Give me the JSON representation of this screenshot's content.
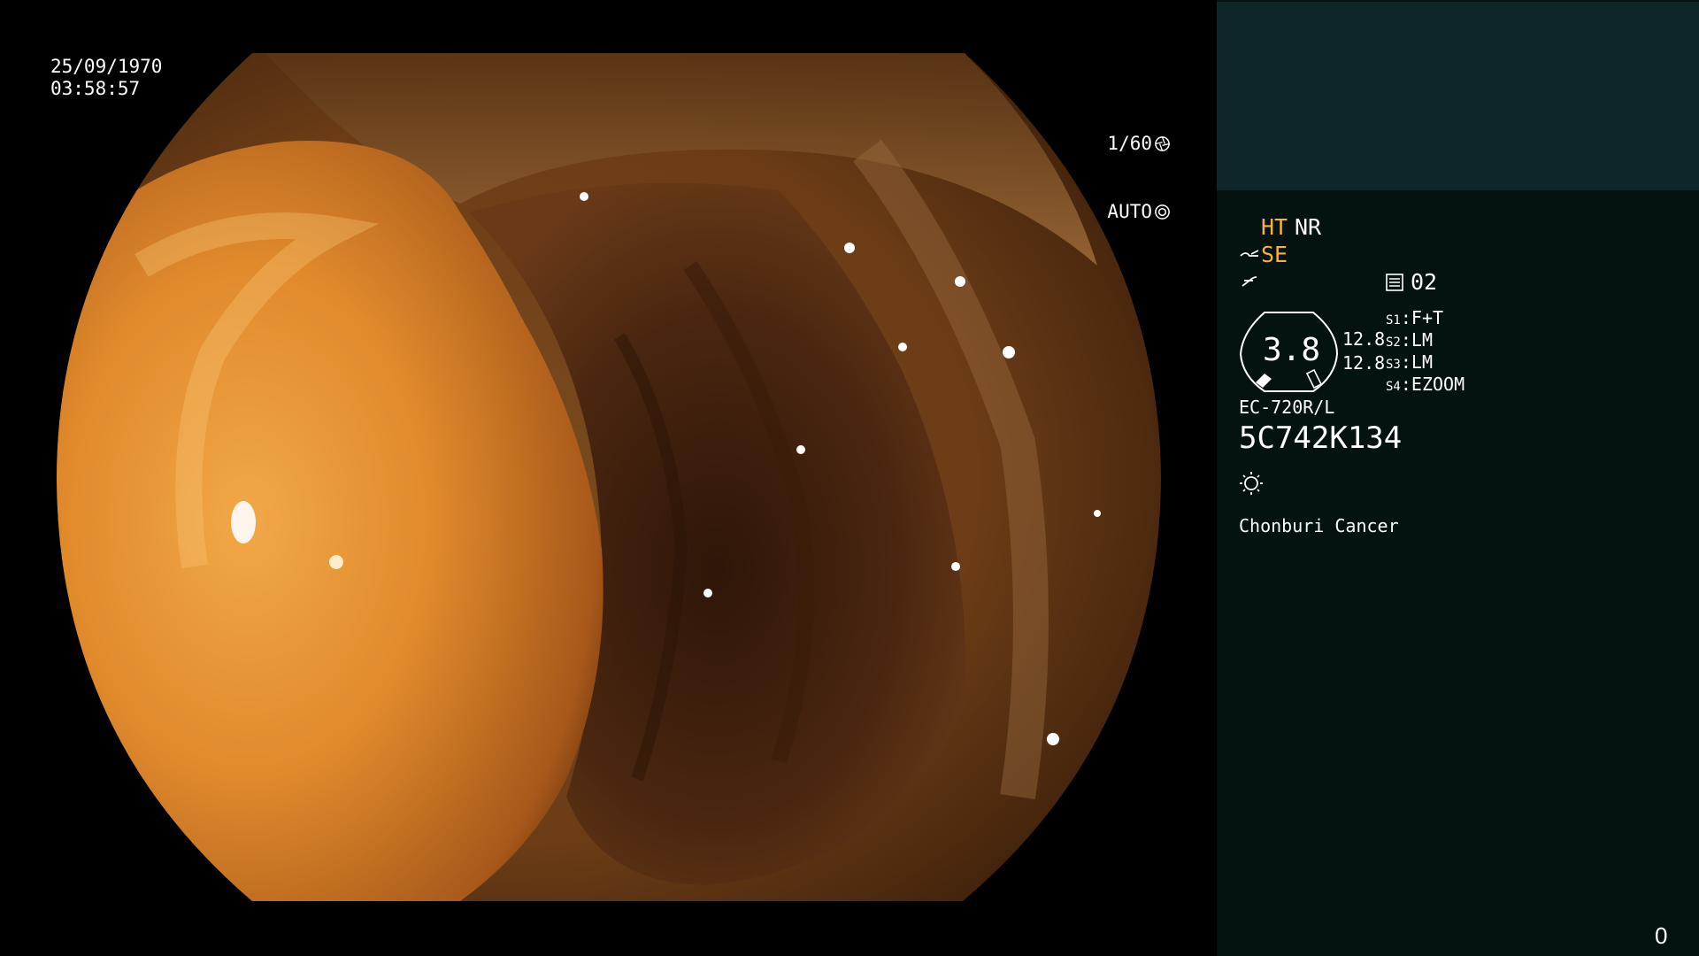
{
  "overlay": {
    "date": "25/09/1970",
    "time": "03:58:57",
    "shutter": "1/60",
    "iris": "AUTO"
  },
  "panel": {
    "ht": "HT",
    "nr": "NR",
    "se": "SE",
    "program": "02",
    "zoom_value": "3.8",
    "gauge_values": [
      "12.8",
      "12.8"
    ],
    "switches": [
      {
        "key": "S1",
        "value": "F+T"
      },
      {
        "key": "S2",
        "value": "LM"
      },
      {
        "key": "S3",
        "value": "LM"
      },
      {
        "key": "S4",
        "value": "EZOOM"
      }
    ],
    "model": "EC-720R/L",
    "serial": "5C742K134",
    "hospital": "Chonburi Cancer",
    "counter": "0"
  },
  "colors": {
    "panel_bg": "#041210",
    "panel_top_bg": "#0f2628",
    "accent_amber": "#f5b33a"
  },
  "icons": {
    "shutter": "aperture-icon",
    "iris": "iris-icon",
    "edge": "edge-enhance-icon",
    "wb": "white-balance-icon",
    "program": "memory-card-icon",
    "lamp": "lamp-icon"
  }
}
